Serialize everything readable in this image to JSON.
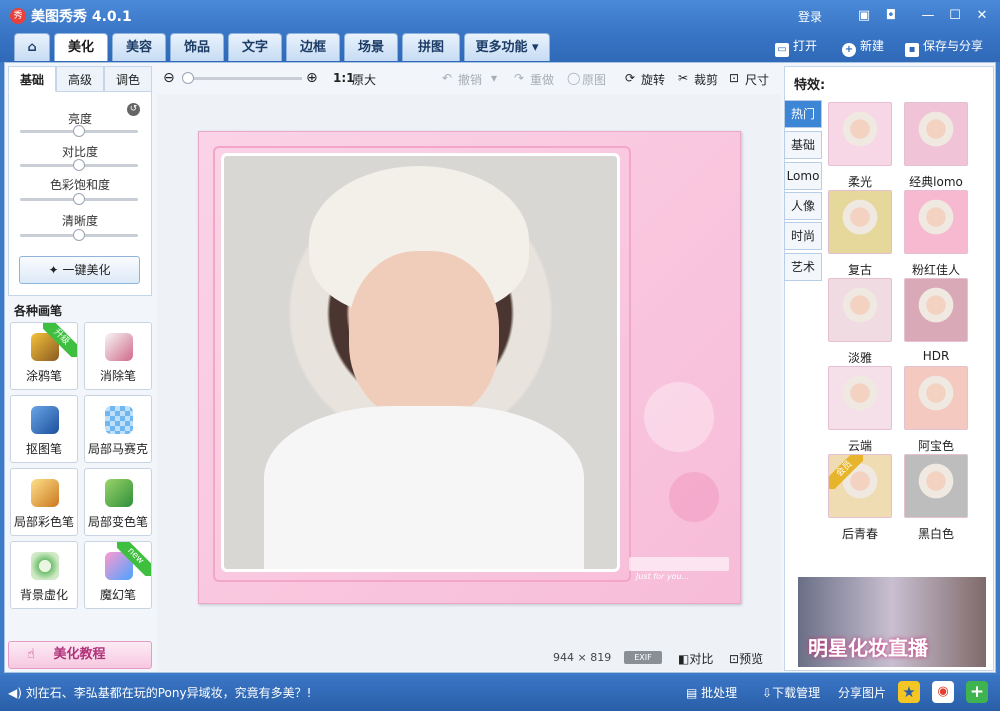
{
  "window": {
    "title": "美图秀秀 4.0.1",
    "logo_text": "秀",
    "login": "登录"
  },
  "nav_tabs": [
    "美化",
    "美容",
    "饰品",
    "文字",
    "边框",
    "场景",
    "拼图",
    "更多功能"
  ],
  "nav_home_icon": "home-icon",
  "actions": {
    "open": "打开",
    "new": "新建",
    "save_share": "保存与分享"
  },
  "adjust": {
    "tabs": [
      "基础",
      "高级",
      "调色"
    ],
    "active_tab": "基础",
    "sliders": [
      {
        "label": "亮度",
        "value": 0.5
      },
      {
        "label": "对比度",
        "value": 0.5
      },
      {
        "label": "色彩饱和度",
        "value": 0.5
      },
      {
        "label": "清晰度",
        "value": 0.5
      }
    ],
    "one_click": "一键美化"
  },
  "brushes": {
    "title": "各种画笔",
    "items": [
      {
        "label": "涂鸦笔",
        "badge": "升级",
        "icon": "paintbrush-icon"
      },
      {
        "label": "消除笔",
        "icon": "eraser-icon"
      },
      {
        "label": "抠图笔",
        "icon": "pen-icon"
      },
      {
        "label": "局部马赛克",
        "icon": "mosaic-icon"
      },
      {
        "label": "局部彩色笔",
        "icon": "color-brush-icon"
      },
      {
        "label": "局部变色笔",
        "icon": "paint-bucket-icon"
      },
      {
        "label": "背景虚化",
        "icon": "blur-icon"
      },
      {
        "label": "魔幻笔",
        "badge": "new",
        "icon": "magic-pen-icon"
      }
    ]
  },
  "tutorial": "美化教程",
  "toolbar": {
    "ratio": "1:1",
    "original_size": "原大",
    "undo": "撤销",
    "redo": "重做",
    "original": "原图",
    "rotate": "旋转",
    "crop": "裁剪",
    "size": "尺寸"
  },
  "canvas": {
    "width": "944",
    "times": "×",
    "height": "819",
    "exif": "EXIF",
    "compare": "对比",
    "preview": "预览",
    "frame_text": "Just for you..."
  },
  "effects": {
    "title": "特效:",
    "tabs": [
      "热门",
      "基础",
      "Lomo",
      "人像",
      "时尚",
      "艺术"
    ],
    "active_tab": "热门",
    "items": [
      {
        "label": "柔光",
        "tint": "#f7d6e6"
      },
      {
        "label": "经典lomo",
        "tint": "#f0c4d6"
      },
      {
        "label": "复古",
        "tint": "#e6d79a"
      },
      {
        "label": "粉红佳人",
        "tint": "#f6b9cf"
      },
      {
        "label": "淡雅",
        "tint": "#f0dbe3"
      },
      {
        "label": "HDR",
        "tint": "#d9a9b8"
      },
      {
        "label": "云端",
        "tint": "#f5dfe8"
      },
      {
        "label": "阿宝色",
        "tint": "#f3c9c0"
      },
      {
        "label": "后青春",
        "tint": "#f0dcb3",
        "badge": "会员"
      },
      {
        "label": "黑白色",
        "tint": "#bdbdbd"
      }
    ]
  },
  "banner": {
    "text": "明星化妆直播"
  },
  "bottom": {
    "ticker": "刘在石、李弘基都在玩的Pony异域妆，究竟有多美？!",
    "batch": "批处理",
    "download": "下载管理",
    "share": "分享图片"
  }
}
